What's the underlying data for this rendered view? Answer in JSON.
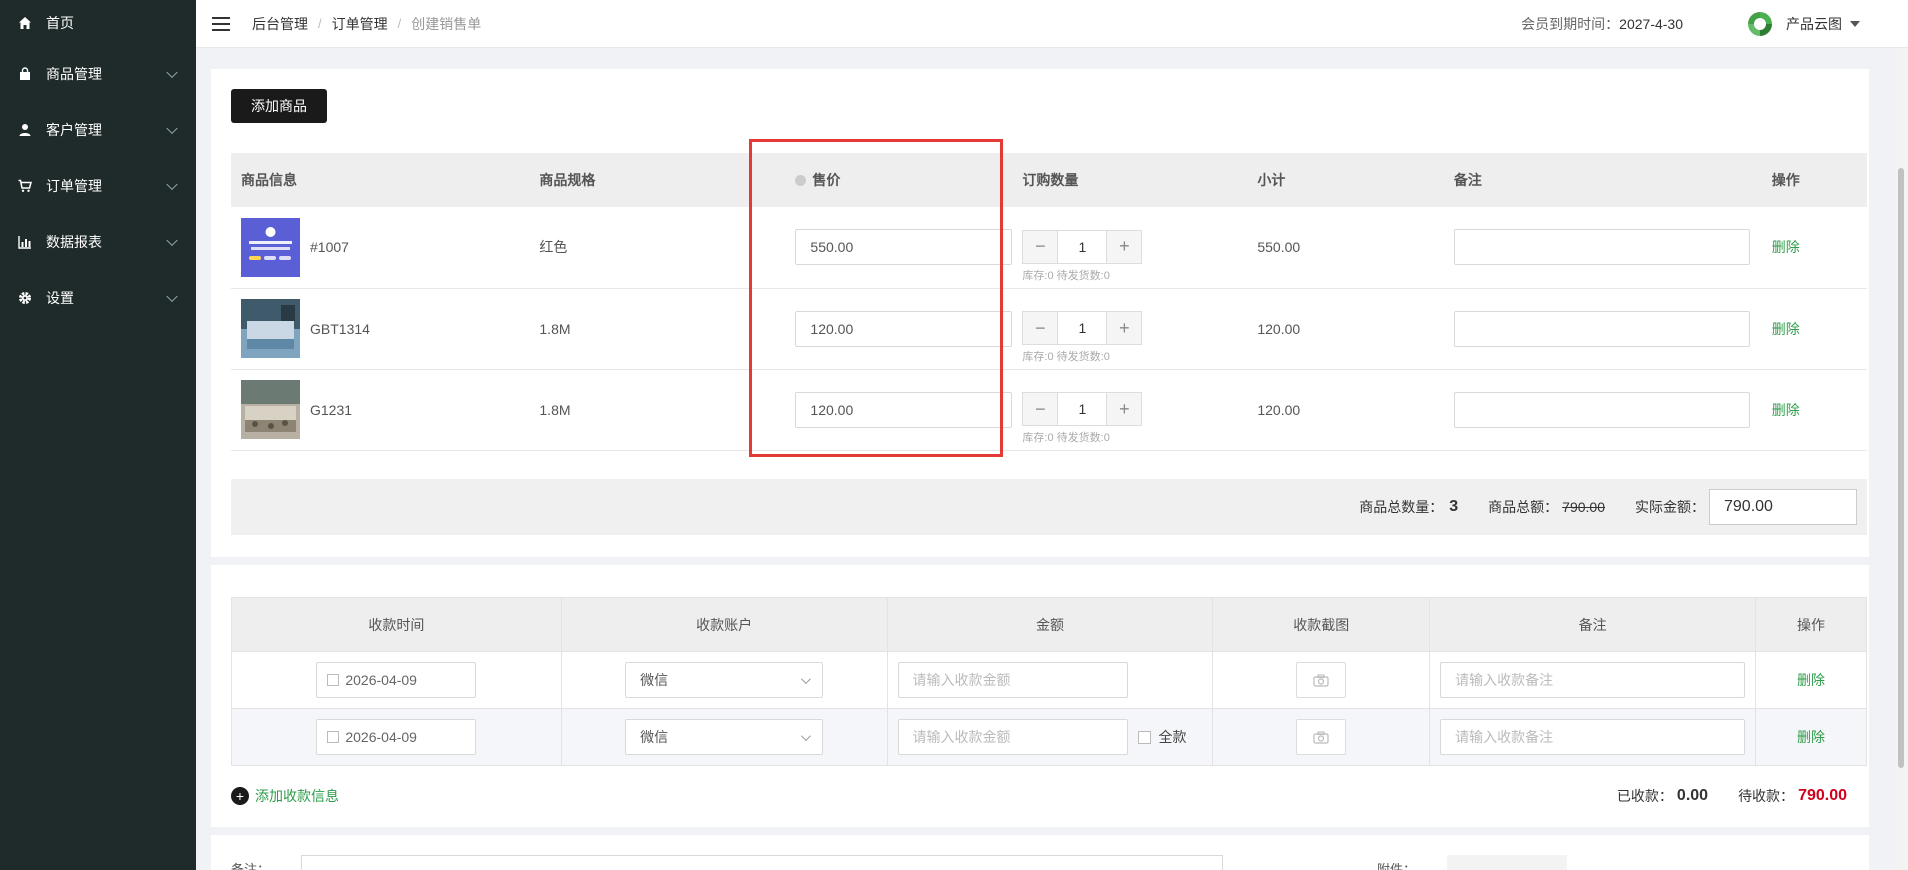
{
  "sidebar": {
    "items": [
      {
        "label": "首页",
        "icon": "home-icon"
      },
      {
        "label": "商品管理",
        "icon": "bag-icon"
      },
      {
        "label": "客户管理",
        "icon": "user-icon"
      },
      {
        "label": "订单管理",
        "icon": "cart-icon"
      },
      {
        "label": "数据报表",
        "icon": "chart-icon"
      },
      {
        "label": "设置",
        "icon": "gear-icon"
      }
    ]
  },
  "header": {
    "breadcrumb": [
      "后台管理",
      "订单管理",
      "创建销售单"
    ],
    "breadcrumb_sep": "/",
    "member_label": "会员到期时间：",
    "member_date": "2027-4-30",
    "brand_name": "产品云图"
  },
  "products": {
    "add_button": "添加商品",
    "columns": [
      "商品信息",
      "商品规格",
      "售价",
      "订购数量",
      "小计",
      "备注",
      "操作"
    ],
    "rows": [
      {
        "code": "#1007",
        "spec": "红色",
        "price": "550.00",
        "qty": "1",
        "stock": "库存:0 待发货数:0",
        "subtotal": "550.00",
        "action": "删除"
      },
      {
        "code": "GBT1314",
        "spec": "1.8M",
        "price": "120.00",
        "qty": "1",
        "stock": "库存:0 待发货数:0",
        "subtotal": "120.00",
        "action": "删除"
      },
      {
        "code": "G1231",
        "spec": "1.8M",
        "price": "120.00",
        "qty": "1",
        "stock": "库存:0 待发货数:0",
        "subtotal": "120.00",
        "action": "删除"
      }
    ],
    "qty_minus": "−",
    "qty_plus": "+"
  },
  "summary": {
    "total_qty_label": "商品总数量：",
    "total_qty": "3",
    "total_amount_label": "商品总额：",
    "total_amount": "790.00",
    "actual_label": "实际金额：",
    "actual_value": "790.00"
  },
  "payments": {
    "columns": [
      "收款时间",
      "收款账户",
      "金额",
      "收款截图",
      "备注",
      "操作"
    ],
    "rows": [
      {
        "date": "2026-04-09",
        "account": "微信",
        "amount_placeholder": "请输入收款金额",
        "remark_placeholder": "请输入收款备注",
        "action": "删除",
        "full_label": ""
      },
      {
        "date": "2026-04-09",
        "account": "微信",
        "amount_placeholder": "请输入收款金额",
        "remark_placeholder": "请输入收款备注",
        "action": "删除",
        "full_label": "全款"
      }
    ],
    "add_label": "添加收款信息",
    "received_label": "已收款：",
    "received_value": "0.00",
    "pending_label": "待收款：",
    "pending_value": "790.00"
  },
  "footer": {
    "remark_label": "备注：",
    "attachment_label": "附件："
  },
  "colors": {
    "sidebar_bg": "#1f2a2a",
    "accent_green": "#2e9d4a",
    "highlight_red": "#e53935",
    "pending_red": "#d0021b"
  }
}
